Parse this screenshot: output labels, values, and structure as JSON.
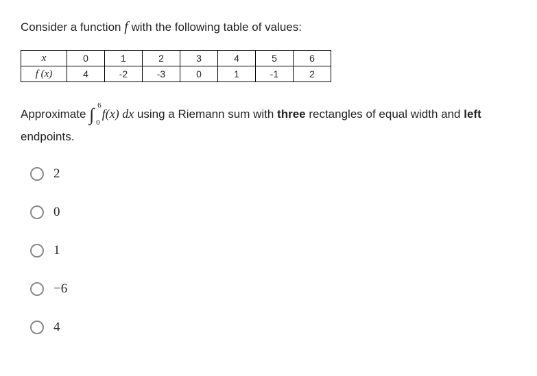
{
  "prompt": {
    "pre": "Consider a function ",
    "fn": "f",
    "post": " with the following table of values:"
  },
  "table": {
    "row_labels": {
      "x": "x",
      "fx": "f (x)"
    },
    "x": [
      "0",
      "1",
      "2",
      "3",
      "4",
      "5",
      "6"
    ],
    "fx": [
      "4",
      "-2",
      "-3",
      "0",
      "1",
      "-1",
      "2"
    ]
  },
  "question": {
    "pre": "Approximate ",
    "int_upper": "6",
    "int_lower": "0",
    "integrand": "f(x) dx",
    "mid1": " using a Riemann sum with ",
    "bold1": "three",
    "mid2": " rectangles of equal width and ",
    "bold2": "left",
    "post": " endpoints."
  },
  "options": [
    "2",
    "0",
    "1",
    "−6",
    "4"
  ]
}
